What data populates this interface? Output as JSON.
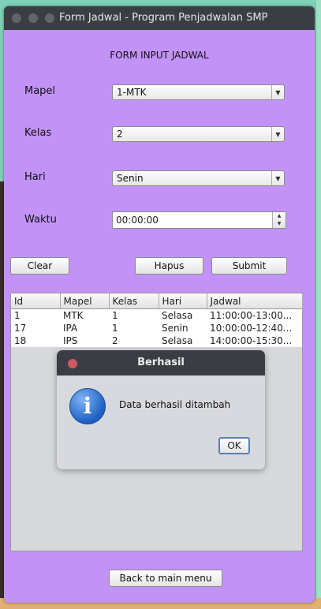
{
  "window": {
    "title": "Form Jadwal - Program Penjadwalan SMP"
  },
  "form": {
    "heading": "FORM INPUT JADWAL",
    "mapel_label": "Mapel",
    "mapel_value": "1-MTK",
    "kelas_label": "Kelas",
    "kelas_value": "2",
    "hari_label": "Hari",
    "hari_value": "Senin",
    "waktu_label": "Waktu",
    "waktu_value": "00:00:00"
  },
  "buttons": {
    "clear": "Clear",
    "hapus": "Hapus",
    "submit": "Submit",
    "back": "Back to main menu"
  },
  "table": {
    "columns": [
      "Id",
      "Mapel",
      "Kelas",
      "Hari",
      "Jadwal"
    ],
    "rows": [
      [
        "1",
        "MTK",
        "1",
        "Selasa",
        "11:00:00-13:00..."
      ],
      [
        "17",
        "IPA",
        "1",
        "Senin",
        "10:00:00-12:40..."
      ],
      [
        "18",
        "IPS",
        "2",
        "Selasa",
        "14:00:00-15:30..."
      ]
    ]
  },
  "dialog": {
    "title": "Berhasil",
    "message": "Data berhasil ditambah",
    "ok": "OK",
    "icon": "info-icon"
  },
  "colors": {
    "window_bg": "#c292f7",
    "titlebar": "#3a3d44"
  }
}
